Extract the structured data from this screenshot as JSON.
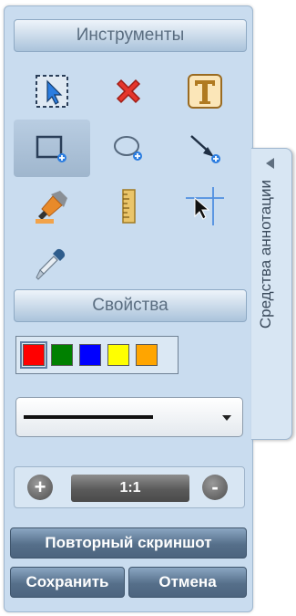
{
  "tools_panel": {
    "header": "Инструменты",
    "tools": [
      {
        "name": "select-tool",
        "icon": "selection-cursor-icon",
        "active": false
      },
      {
        "name": "delete-tool",
        "icon": "red-x-icon",
        "active": false
      },
      {
        "name": "text-tool",
        "icon": "text-t-icon",
        "active": false
      },
      {
        "name": "rectangle-tool",
        "icon": "rectangle-plus-icon",
        "active": true
      },
      {
        "name": "ellipse-tool",
        "icon": "ellipse-plus-icon",
        "active": false
      },
      {
        "name": "arrow-tool",
        "icon": "arrow-line-icon",
        "active": false
      },
      {
        "name": "highlighter-tool",
        "icon": "highlighter-icon",
        "active": false
      },
      {
        "name": "ruler-tool",
        "icon": "ruler-icon",
        "active": false
      },
      {
        "name": "crosshair-tool",
        "icon": "crosshair-cursor-icon",
        "active": false
      },
      {
        "name": "eyedropper-tool",
        "icon": "eyedropper-icon",
        "active": false
      }
    ]
  },
  "properties": {
    "header": "Свойства",
    "colors": [
      "#ff0000",
      "#008000",
      "#0000ff",
      "#ffff00",
      "#ffa500"
    ],
    "selected_color": "#ff0000"
  },
  "zoom": {
    "level": "1:1",
    "plus_label": "+",
    "minus_label": "-"
  },
  "buttons": {
    "retake": "Повторный скриншот",
    "save": "Сохранить",
    "cancel": "Отмена"
  },
  "side_tab": {
    "label": "Средства аннотации"
  }
}
